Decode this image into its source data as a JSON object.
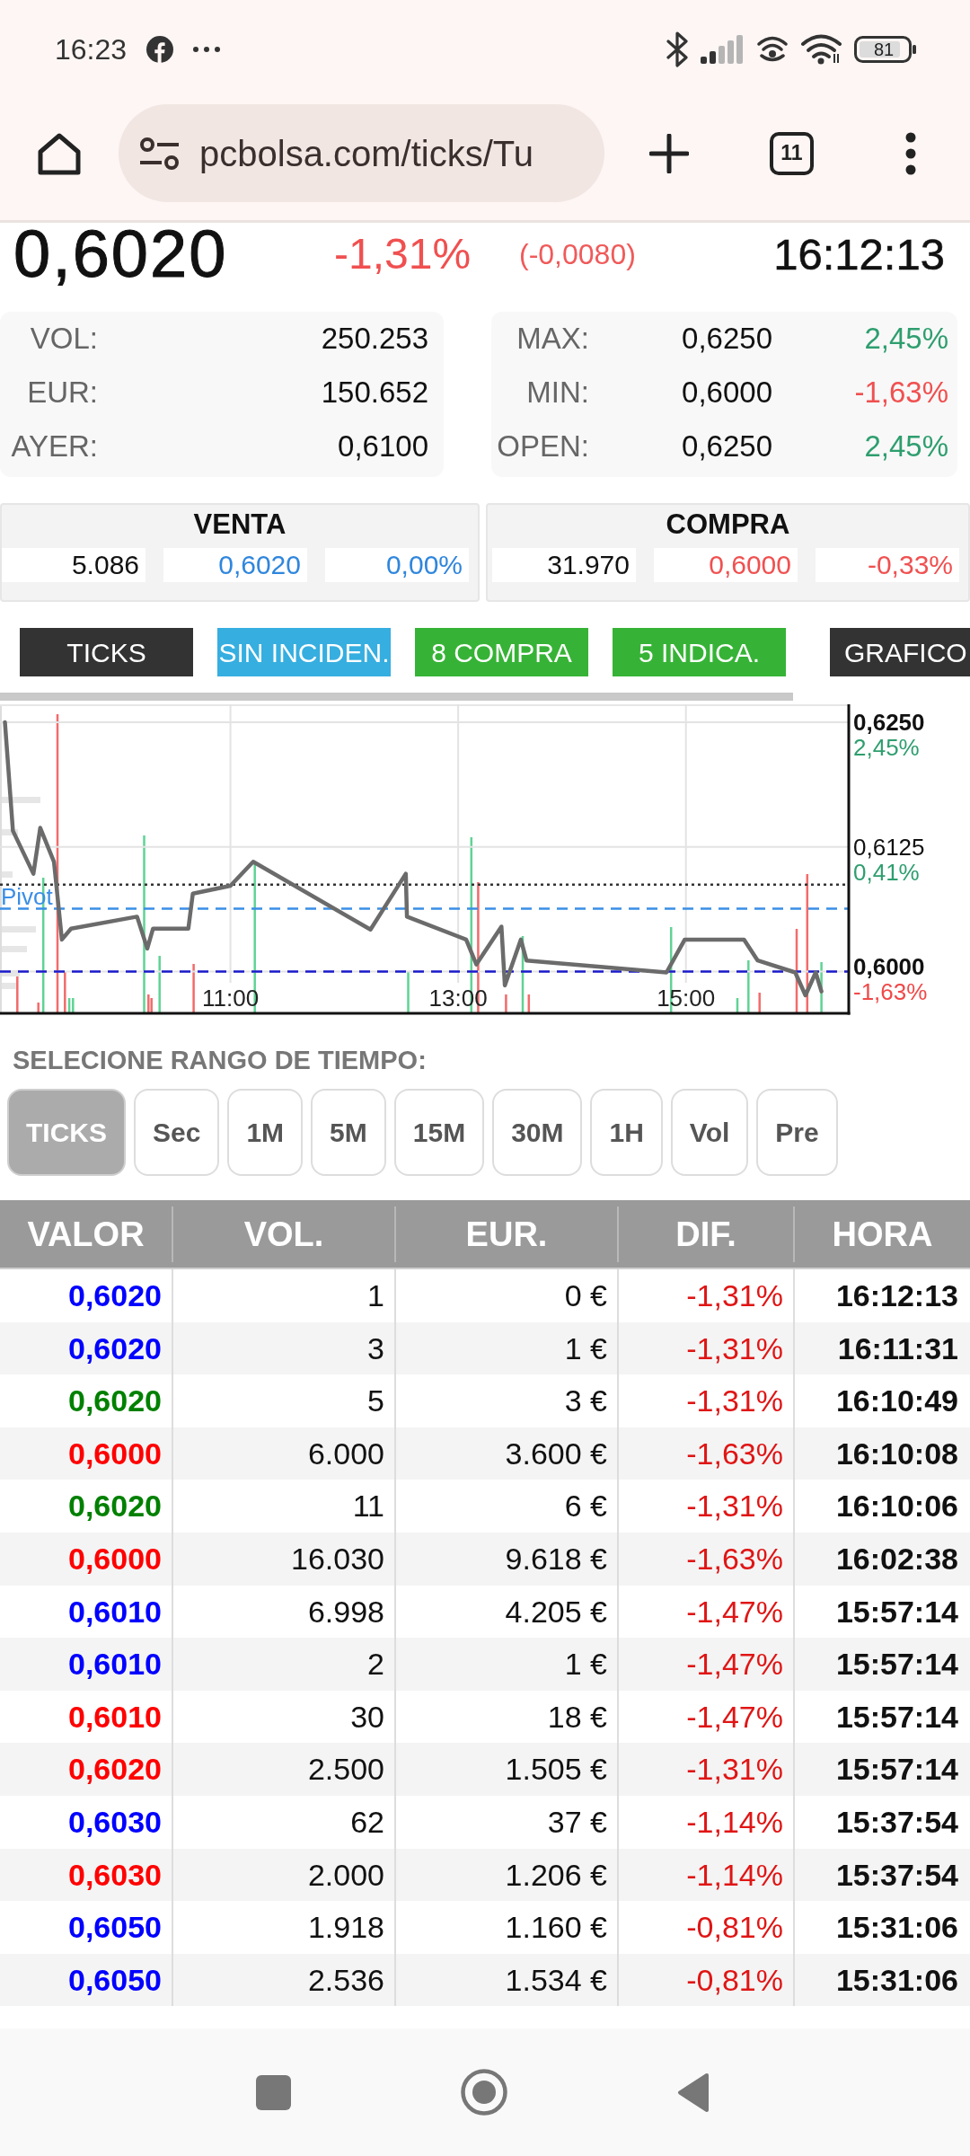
{
  "status_bar": {
    "time": "16:23",
    "battery": "81"
  },
  "browser": {
    "url": "pcbolsa.com/ticks/Tu",
    "tab_count": "11"
  },
  "quote": {
    "price": "0,6020",
    "change_pct": "-1,31%",
    "change_abs": "(-0,0080)",
    "time": "16:12:13"
  },
  "stats": {
    "left": [
      {
        "label": "VOL:",
        "value": "250.253"
      },
      {
        "label": "EUR:",
        "value": "150.652"
      },
      {
        "label": "AYER:",
        "value": "0,6100"
      }
    ],
    "right": [
      {
        "label": "MAX:",
        "value": "0,6250",
        "change": "2,45%",
        "color": "#2e9e6e"
      },
      {
        "label": "MIN:",
        "value": "0,6000",
        "change": "-1,63%",
        "color": "#f05050"
      },
      {
        "label": "OPEN:",
        "value": "0,6250",
        "change": "2,45%",
        "color": "#2e9e6e"
      }
    ]
  },
  "order_book": [
    {
      "title": "VENTA",
      "cells": [
        {
          "text": "5.086",
          "color": "#111111"
        },
        {
          "text": "0,6020",
          "color": "#2f86dd"
        },
        {
          "text": "0,00%",
          "color": "#2f86dd"
        }
      ]
    },
    {
      "title": "COMPRA",
      "cells": [
        {
          "text": "31.970",
          "color": "#111111"
        },
        {
          "text": "0,6000",
          "color": "#f05050"
        },
        {
          "text": "-0,33%",
          "color": "#f05050"
        }
      ]
    }
  ],
  "tabs": [
    {
      "label": "TICKS",
      "color": "#333333"
    },
    {
      "label": "SIN INCIDEN.",
      "color": "#36aee0"
    },
    {
      "label": "8 COMPRA",
      "color": "#36b336"
    },
    {
      "label": "5 INDICA.",
      "color": "#36b336"
    },
    {
      "label": "GRAFICO",
      "color": "#333333"
    }
  ],
  "chart": {
    "chart_data": {
      "type": "line",
      "x": [
        9.02,
        9.09,
        9.27,
        9.33,
        9.45,
        9.52,
        9.6,
        10.18,
        10.27,
        10.32,
        10.63,
        10.67,
        11.0,
        11.2,
        12.23,
        12.54,
        12.55,
        13.07,
        13.16,
        13.38,
        13.41,
        13.55,
        13.6,
        14.83,
        14.99,
        15.51,
        15.63,
        15.96,
        16.05,
        16.14,
        16.19
      ],
      "series": [
        {
          "color": "#6b6b6b",
          "values": [
            0.625,
            0.6141,
            0.6098,
            0.6144,
            0.611,
            0.6032,
            0.6043,
            0.6055,
            0.6023,
            0.6043,
            0.6043,
            0.6078,
            0.6086,
            0.611,
            0.6042,
            0.6098,
            0.6055,
            0.6032,
            0.6007,
            0.6045,
            0.5986,
            0.6032,
            0.6011,
            0.5999,
            0.6032,
            0.6032,
            0.6011,
            0.5999,
            0.5976,
            0.5999,
            0.598
          ]
        }
      ],
      "xlim": [
        9,
        16.43
      ],
      "ylim": [
        0.5958,
        0.6268
      ],
      "xticks": [
        {
          "value": 11,
          "label": "11:00"
        },
        {
          "value": 13,
          "label": "13:00"
        },
        {
          "value": 15,
          "label": "15:00"
        }
      ],
      "yticks": [
        {
          "value": 0.625,
          "label": "0,6250"
        },
        {
          "value": 0.6125,
          "label": "0,6125"
        },
        {
          "value": 0.6,
          "label": "0,6000"
        }
      ],
      "grid": true,
      "ref_lines": [
        {
          "axis": "y",
          "value": 0.6087,
          "color": "#333333"
        },
        {
          "axis": "y",
          "value": 0.6063,
          "label": "Pivot",
          "color": "#3a8ee6"
        },
        {
          "axis": "y",
          "value": 0.6,
          "color": "#1a1acc"
        }
      ]
    },
    "axis_percents": [
      {
        "text": "2,45%",
        "color": "#2e9e6e"
      },
      {
        "text": "0,41%",
        "color": "#2e9e6e"
      },
      {
        "text": "-1,63%",
        "color": "#f04848"
      }
    ]
  },
  "range_selector": {
    "label": "SELECIONE RANGO DE TIEMPO:",
    "options": [
      {
        "label": "TICKS",
        "selected": true
      },
      {
        "label": "Sec",
        "selected": false
      },
      {
        "label": "1M",
        "selected": false
      },
      {
        "label": "5M",
        "selected": false
      },
      {
        "label": "15M",
        "selected": false
      },
      {
        "label": "30M",
        "selected": false
      },
      {
        "label": "1H",
        "selected": false
      },
      {
        "label": "Vol",
        "selected": false
      },
      {
        "label": "Pre",
        "selected": false
      }
    ]
  },
  "table": {
    "columns": [
      "VALOR",
      "VOL.",
      "EUR.",
      "DIF.",
      "HORA"
    ],
    "rows": [
      {
        "cells": [
          "0,6020",
          "1",
          "0 €",
          "-1,31%",
          "16:12:13"
        ],
        "color": "#0000ff"
      },
      {
        "cells": [
          "0,6020",
          "3",
          "1 €",
          "-1,31%",
          "16:11:31"
        ],
        "color": "#0000ff"
      },
      {
        "cells": [
          "0,6020",
          "5",
          "3 €",
          "-1,31%",
          "16:10:49"
        ],
        "color": "#008000"
      },
      {
        "cells": [
          "0,6000",
          "6.000",
          "3.600 €",
          "-1,63%",
          "16:10:08"
        ],
        "color": "#ff0000"
      },
      {
        "cells": [
          "0,6020",
          "11",
          "6 €",
          "-1,31%",
          "16:10:06"
        ],
        "color": "#008000"
      },
      {
        "cells": [
          "0,6000",
          "16.030",
          "9.618 €",
          "-1,63%",
          "16:02:38"
        ],
        "color": "#ff0000"
      },
      {
        "cells": [
          "0,6010",
          "6.998",
          "4.205 €",
          "-1,47%",
          "15:57:14"
        ],
        "color": "#0000ff"
      },
      {
        "cells": [
          "0,6010",
          "2",
          "1 €",
          "-1,47%",
          "15:57:14"
        ],
        "color": "#0000ff"
      },
      {
        "cells": [
          "0,6010",
          "30",
          "18 €",
          "-1,47%",
          "15:57:14"
        ],
        "color": "#ff0000"
      },
      {
        "cells": [
          "0,6020",
          "2.500",
          "1.505 €",
          "-1,31%",
          "15:57:14"
        ],
        "color": "#ff0000"
      },
      {
        "cells": [
          "0,6030",
          "62",
          "37 €",
          "-1,14%",
          "15:37:54"
        ],
        "color": "#0000ff"
      },
      {
        "cells": [
          "0,6030",
          "2.000",
          "1.206 €",
          "-1,14%",
          "15:37:54"
        ],
        "color": "#ff0000"
      },
      {
        "cells": [
          "0,6050",
          "1.918",
          "1.160 €",
          "-0,81%",
          "15:31:06"
        ],
        "color": "#0000ff"
      },
      {
        "cells": [
          "0,6050",
          "2.536",
          "1.534 €",
          "-0,81%",
          "15:31:06"
        ],
        "color": "#0000ff"
      }
    ]
  }
}
